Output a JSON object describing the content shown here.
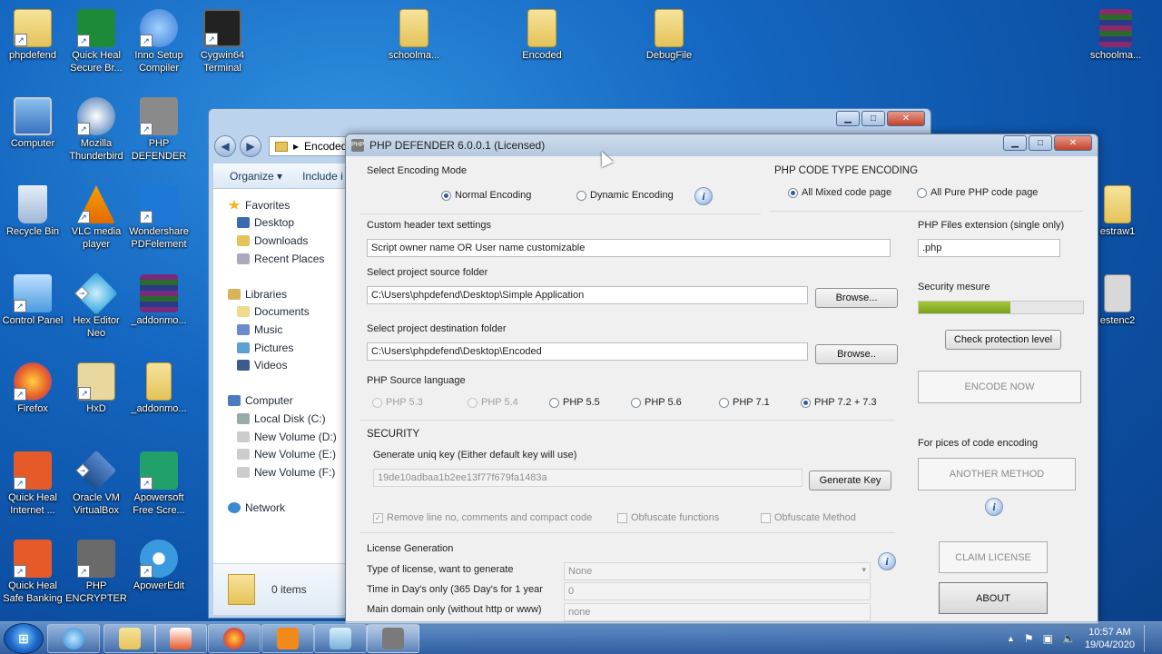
{
  "desktop": {
    "icons": [
      {
        "label": "phpdefend",
        "color": "#e3c25c"
      },
      {
        "label": "Quick Heal Secure Br...",
        "color": "#1d8a3a"
      },
      {
        "label": "Inno Setup Compiler",
        "color": "#3a7bd5"
      },
      {
        "label": "Cygwin64 Terminal",
        "color": "#222222"
      },
      {
        "label": "Computer",
        "color": "#4a8ad8"
      },
      {
        "label": "Mozilla Thunderbird",
        "color": "#3a6fb0"
      },
      {
        "label": "PHP DEFENDER",
        "color": "#8a8a8a"
      },
      {
        "label": "Recycle Bin",
        "color": "#9fb7d6"
      },
      {
        "label": "VLC media player",
        "color": "#f08a00"
      },
      {
        "label": "Wondershare PDFelement",
        "color": "#1e78d8"
      },
      {
        "label": "Control Panel",
        "color": "#4b9be0"
      },
      {
        "label": "Hex Editor Neo",
        "color": "#2aa0d8"
      },
      {
        "label": "_addonmo...",
        "color": "#7a2a7a"
      },
      {
        "label": "Firefox",
        "color": "#e8622a"
      },
      {
        "label": "HxD",
        "color": "#c8b070"
      },
      {
        "label": "_addonmo...",
        "color": "#e3c25c"
      },
      {
        "label": "Quick Heal Internet ...",
        "color": "#e65a2a"
      },
      {
        "label": "Oracle VM VirtualBox",
        "color": "#1e4e8a"
      },
      {
        "label": "Apowersoft Free Scre...",
        "color": "#22a06a"
      },
      {
        "label": "Quick Heal Safe Banking",
        "color": "#e65a2a"
      },
      {
        "label": "PHP ENCRYPTER",
        "color": "#6a6a6a"
      },
      {
        "label": "ApowerEdit",
        "color": "#3a9ae0"
      },
      {
        "label": "schoolma...",
        "color": "#e3c25c"
      },
      {
        "label": "Encoded",
        "color": "#e3c25c"
      },
      {
        "label": "DebugFile",
        "color": "#e3c25c"
      },
      {
        "label": "schoolma...",
        "color": "#8a2a6a"
      },
      {
        "label": "estraw1",
        "color": "#e3c25c"
      },
      {
        "label": "estenc2",
        "color": "#8a8a8a"
      }
    ]
  },
  "explorer": {
    "address": "Encoded",
    "toolbar": {
      "organize": "Organize ▾",
      "include": "Include i"
    },
    "nav": {
      "favorites": "Favorites",
      "desktop": "Desktop",
      "downloads": "Downloads",
      "recent": "Recent Places",
      "libraries": "Libraries",
      "documents": "Documents",
      "music": "Music",
      "pictures": "Pictures",
      "videos": "Videos",
      "computer": "Computer",
      "disk_c": "Local Disk (C:)",
      "vol_d": "New Volume (D:)",
      "vol_e": "New Volume (E:)",
      "vol_f": "New Volume (F:)",
      "network": "Network"
    },
    "status": "0 items"
  },
  "php": {
    "title": "PHP DEFENDER 6.0.0.1 (Licensed)",
    "encoding_mode": {
      "label": "Select Encoding Mode",
      "normal": "Normal Encoding",
      "dynamic": "Dynamic Encoding"
    },
    "code_type": {
      "label": "PHP CODE TYPE ENCODING",
      "mixed": "All Mixed code page",
      "pure": "All Pure PHP code page"
    },
    "header": {
      "label": "Custom header text settings",
      "value": "Script owner name OR User name customizable"
    },
    "extension": {
      "label": "PHP Files extension (single only)",
      "value": ".php"
    },
    "source": {
      "label": "Select project source folder",
      "value": "C:\\Users\\phpdefend\\Desktop\\Simple Application",
      "browse": "Browse..."
    },
    "destination": {
      "label": "Select project destination folder",
      "value": "C:\\Users\\phpdefend\\Desktop\\Encoded",
      "browse": "Browse.."
    },
    "security_measure": {
      "label": "Security mesure",
      "level": 0.56,
      "check_button": "Check protection level"
    },
    "encode_now": "ENCODE NOW",
    "language": {
      "label": "PHP Source language",
      "options": [
        "PHP 5.3",
        "PHP 5.4",
        "PHP 5.5",
        "PHP 5.6",
        "PHP 7.1",
        "PHP 7.2 + 7.3"
      ]
    },
    "security": {
      "label": "SECURITY",
      "key_label": "Generate uniq key  (Either default key will use)",
      "key_value": "19de10adbaa1b2ee13f77f679fa1483a",
      "generate": "Generate Key",
      "remove_lines": "Remove line no, comments and compact code",
      "obf_functions": "Obfuscate functions",
      "obf_method": "Obfuscate Method"
    },
    "pieces": {
      "label": "For pices of code encoding",
      "another": "ANOTHER METHOD"
    },
    "license": {
      "label": "License Generation",
      "type_label": "Type of license, want to generate",
      "type_value": "None",
      "days_label": "Time in Day's only (365 Day's for 1 year",
      "days_value": "0",
      "domain_label": "Main domain only  (without http or www)",
      "domain_value": "none"
    },
    "claim": "CLAIM LICENSE",
    "about": "ABOUT"
  },
  "taskbar": {
    "time": "10:57 AM",
    "date": "19/04/2020"
  },
  "colors": {
    "progress": "#7a9e1a",
    "accent": "#1466c0"
  }
}
